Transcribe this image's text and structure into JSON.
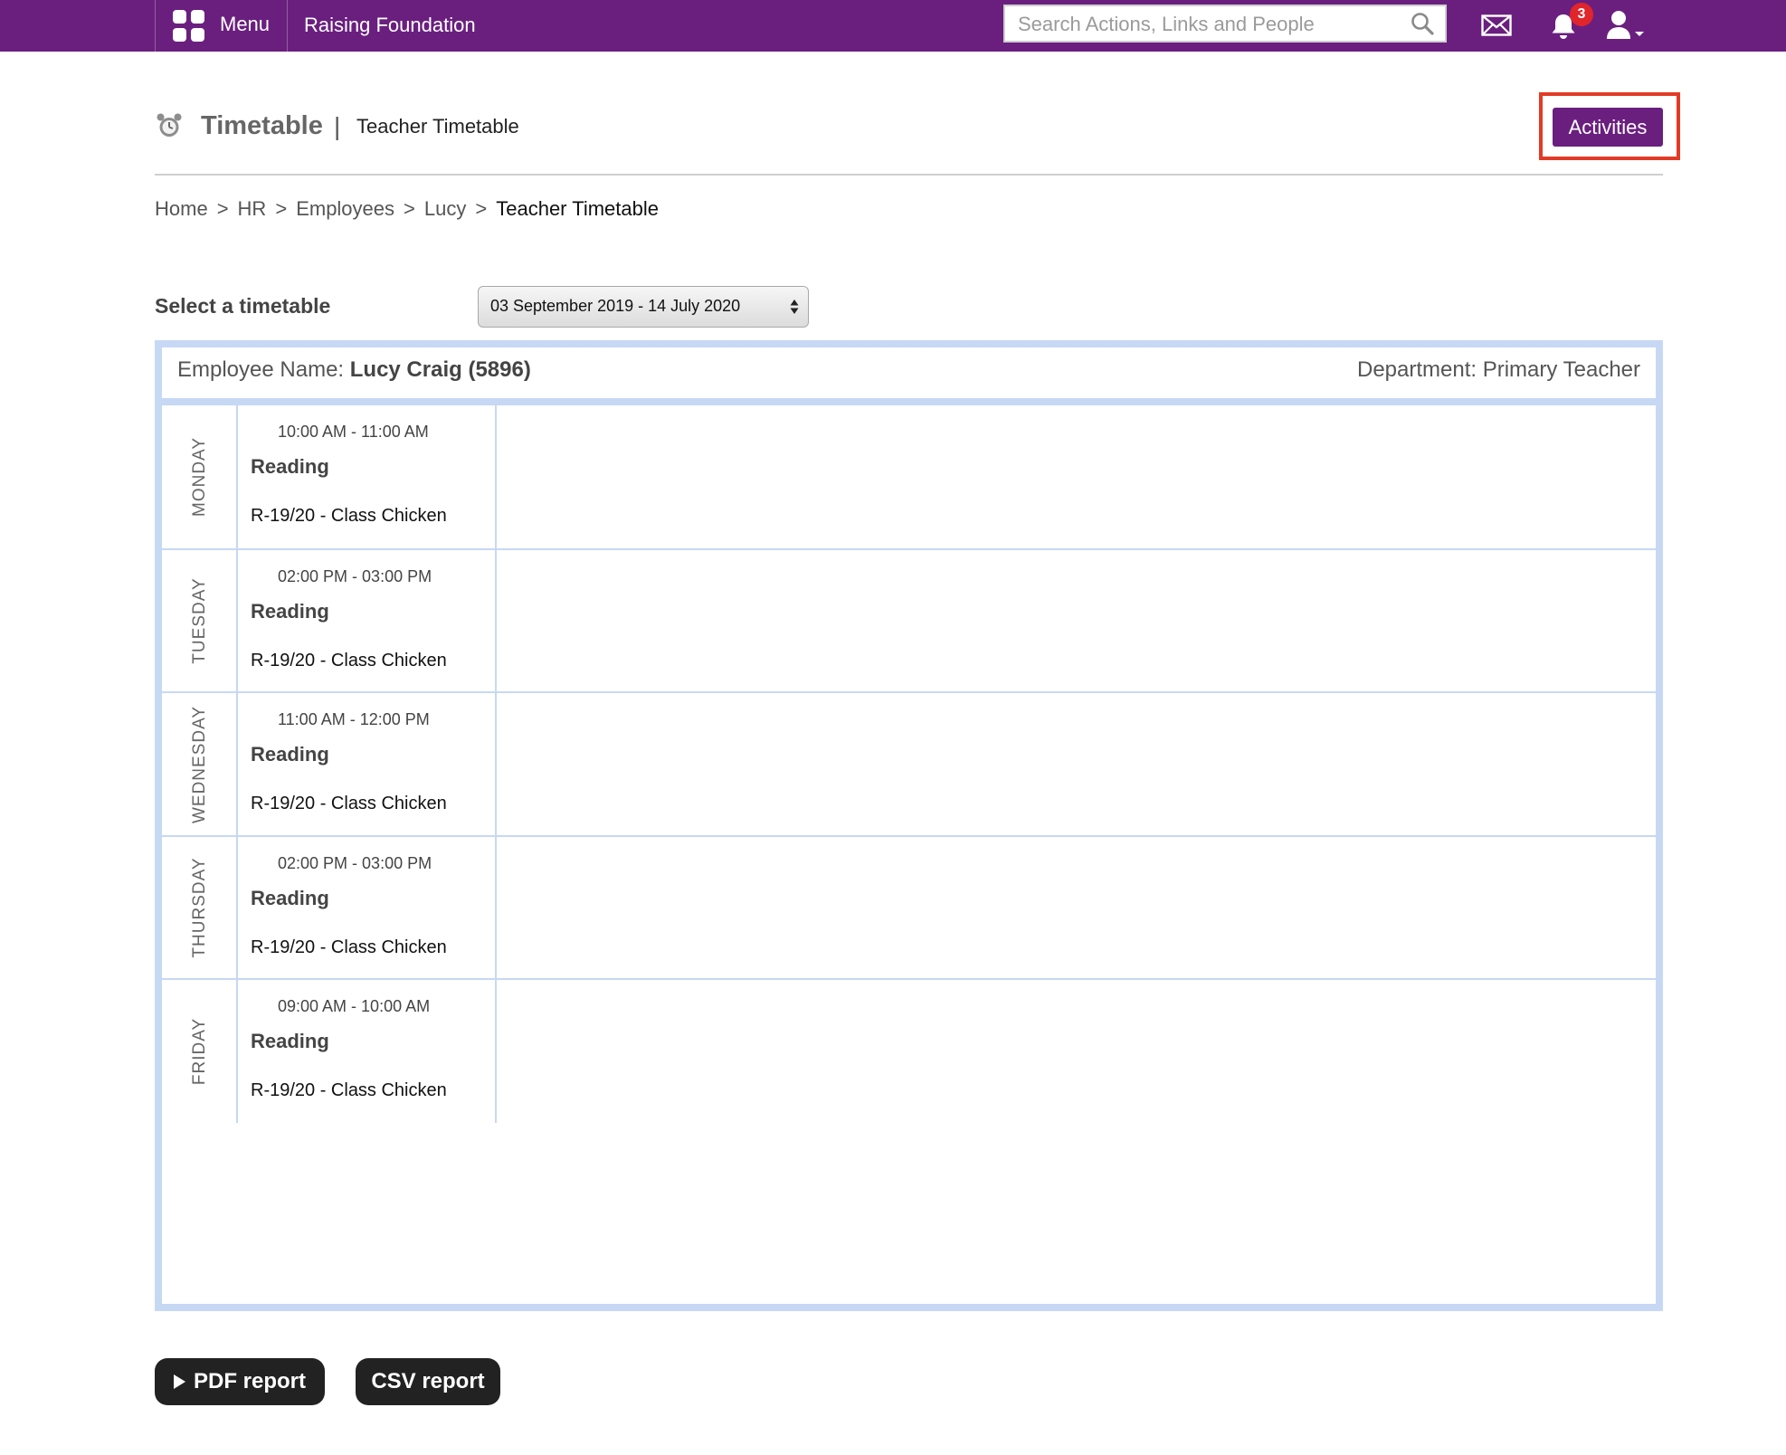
{
  "topbar": {
    "menu_label": "Menu",
    "org_name": "Raising Foundation",
    "search_placeholder": "Search Actions, Links and People",
    "notification_count": "3",
    "accent_color": "#6a1f7f",
    "icons": [
      "grid-icon",
      "search-icon",
      "mail-icon",
      "bell-icon",
      "user-icon"
    ]
  },
  "header": {
    "title": "Timetable",
    "separator": "|",
    "subtitle": "Teacher Timetable",
    "activities_label": "Activities"
  },
  "breadcrumb": {
    "items": [
      "Home",
      "HR",
      "Employees",
      "Lucy"
    ],
    "current": "Teacher Timetable",
    "separator": ">"
  },
  "selector": {
    "label": "Select a timetable",
    "selected": "03 September 2019 - 14 July 2020"
  },
  "employee": {
    "label": "Employee Name:",
    "name": "Lucy Craig (5896)",
    "department_label": "Department:",
    "department": "Primary Teacher"
  },
  "days": [
    {
      "day": "MONDAY",
      "time": "10:00 AM - 11:00 AM",
      "subject": "Reading",
      "class": "R-19/20 - Class Chicken"
    },
    {
      "day": "TUESDAY",
      "time": "02:00 PM - 03:00 PM",
      "subject": "Reading",
      "class": "R-19/20 - Class Chicken"
    },
    {
      "day": "WEDNESDAY",
      "time": "11:00 AM - 12:00 PM",
      "subject": "Reading",
      "class": "R-19/20 - Class Chicken"
    },
    {
      "day": "THURSDAY",
      "time": "02:00 PM - 03:00 PM",
      "subject": "Reading",
      "class": "R-19/20 - Class Chicken"
    },
    {
      "day": "FRIDAY",
      "time": "09:00 AM - 10:00 AM",
      "subject": "Reading",
      "class": "R-19/20 - Class Chicken"
    }
  ],
  "reports": {
    "pdf_label": "PDF report",
    "csv_label": "CSV report"
  }
}
